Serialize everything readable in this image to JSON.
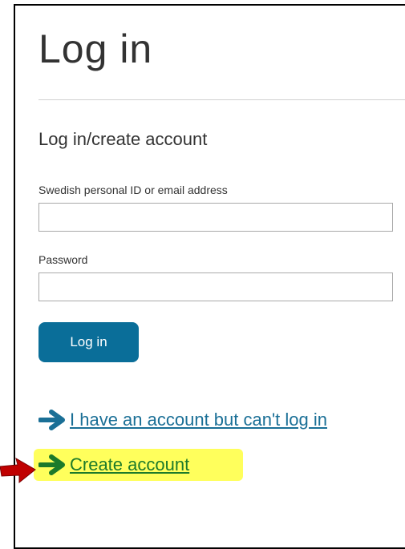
{
  "page": {
    "title": "Log in"
  },
  "form": {
    "section_title": "Log in/create account",
    "id_label": "Swedish personal ID or email address",
    "id_value": "",
    "password_label": "Password",
    "password_value": "",
    "submit_label": "Log in"
  },
  "links": {
    "help": "I have an account but can't log in",
    "create": "Create account"
  },
  "icons": {
    "help_arrow": "arrow-right-icon",
    "create_arrow": "arrow-right-icon",
    "annotation": "red-pointer-arrow-icon"
  },
  "colors": {
    "primary_button": "#0a6e99",
    "help_link": "#1a6f96",
    "create_link": "#1c7a2a",
    "highlight": "#ffff5c",
    "annotation_arrow": "#c00000"
  }
}
